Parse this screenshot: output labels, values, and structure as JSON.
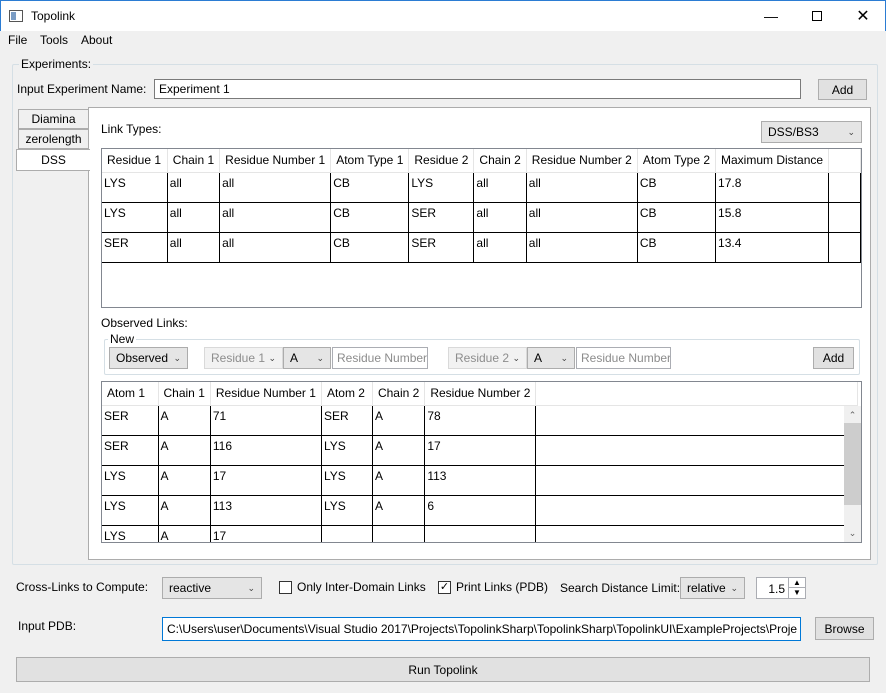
{
  "window": {
    "title": "Topolink",
    "min_icon": "minimize-icon",
    "max_icon": "maximize-icon",
    "close_icon": "close-icon"
  },
  "menu": [
    "File",
    "Tools",
    "About"
  ],
  "experiments": {
    "group_label": "Experiments:",
    "name_label": "Input Experiment Name:",
    "name_value": "Experiment 1",
    "add_label": "Add",
    "tabs": [
      "Diamina",
      "zerolength",
      "DSS"
    ],
    "active_tab": "DSS",
    "link_types_label": "Link Types:",
    "link_types_select": "DSS/BS3",
    "link_types": {
      "columns": [
        "Residue 1",
        "Chain 1",
        "Residue Number 1",
        "Atom Type 1",
        "Residue 2",
        "Chain 2",
        "Residue Number 2",
        "Atom Type 2",
        "Maximum Distance"
      ],
      "rows": [
        [
          "LYS",
          "all",
          "all",
          "CB",
          "LYS",
          "all",
          "all",
          "CB",
          "17.8"
        ],
        [
          "LYS",
          "all",
          "all",
          "CB",
          "SER",
          "all",
          "all",
          "CB",
          "15.8"
        ],
        [
          "SER",
          "all",
          "all",
          "CB",
          "SER",
          "all",
          "all",
          "CB",
          "13.4"
        ]
      ]
    },
    "observed_label": "Observed Links:",
    "new_group_label": "New",
    "new_type": "Observed",
    "residue1_placeholder": "Residue 1",
    "chain1_value": "A",
    "residue_number1_placeholder": "Residue Number",
    "residue2_placeholder": "Residue 2",
    "chain2_value": "A",
    "residue_number2_placeholder": "Residue Number",
    "new_add_label": "Add",
    "observed_links": {
      "columns": [
        "Atom 1",
        "Chain 1",
        "Residue Number 1",
        "Atom 2",
        "Chain 2",
        "Residue Number 2"
      ],
      "rows": [
        [
          "SER",
          "A",
          "71",
          "SER",
          "A",
          "78"
        ],
        [
          "SER",
          "A",
          "116",
          "LYS",
          "A",
          "17"
        ],
        [
          "LYS",
          "A",
          "17",
          "LYS",
          "A",
          "113"
        ],
        [
          "LYS",
          "A",
          "113",
          "LYS",
          "A",
          "6"
        ],
        [
          "LYS",
          "A",
          "17",
          "",
          "",
          ""
        ]
      ]
    }
  },
  "compute": {
    "label": "Cross-Links to Compute:",
    "select": "reactive",
    "inter_domain_label": "Only Inter-Domain Links",
    "inter_domain_checked": false,
    "print_links_label": "Print Links (PDB)",
    "print_links_checked": true,
    "search_limit_label": "Search Distance Limit:",
    "search_limit_mode": "relative",
    "search_limit_value": "1.5"
  },
  "pdb": {
    "label": "Input PDB:",
    "path": "C:\\Users\\user\\Documents\\Visual Studio 2017\\Projects\\TopolinkSharp\\TopolinkSharp\\TopolinkUI\\ExampleProjects\\Proje",
    "browse_label": "Browse"
  },
  "run_label": "Run Topolink"
}
